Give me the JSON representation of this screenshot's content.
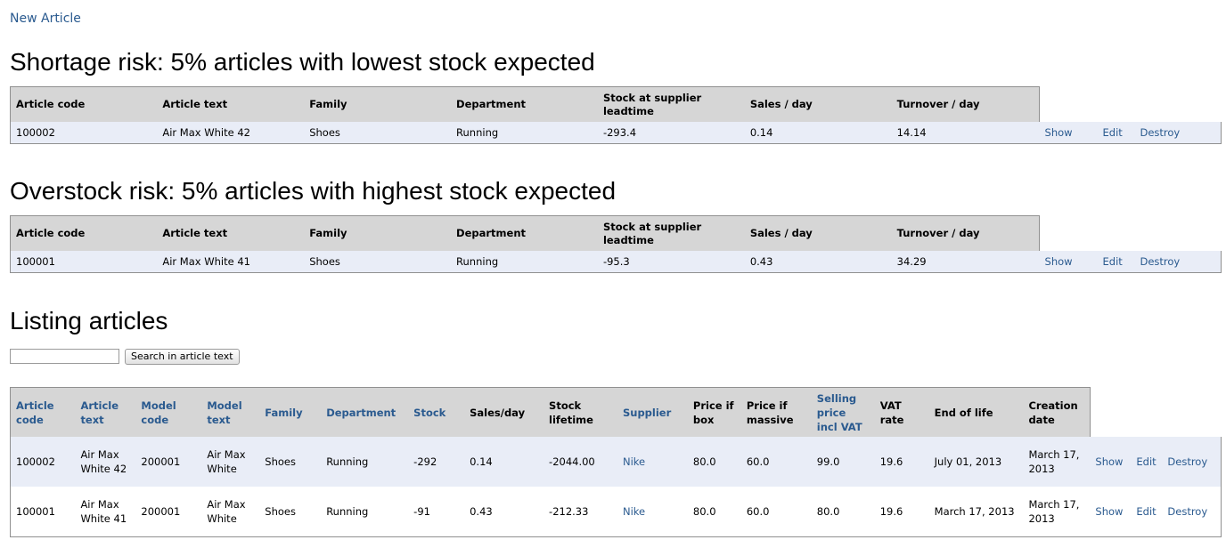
{
  "new_article_link": "New Article",
  "shortage": {
    "title": "Shortage risk: 5% articles with lowest stock expected",
    "headers": [
      "Article code",
      "Article text",
      "Family",
      "Department",
      "Stock at supplier leadtime",
      "Sales / day",
      "Turnover / day"
    ],
    "rows": [
      {
        "cells": [
          "100002",
          "Air Max White 42",
          "Shoes",
          "Running",
          "-293.4",
          "0.14",
          "14.14"
        ],
        "show": "Show",
        "edit": "Edit",
        "destroy": "Destroy"
      }
    ]
  },
  "overstock": {
    "title": "Overstock risk: 5% articles with highest stock expected",
    "headers": [
      "Article code",
      "Article text",
      "Family",
      "Department",
      "Stock at supplier leadtime",
      "Sales / day",
      "Turnover / day"
    ],
    "rows": [
      {
        "cells": [
          "100001",
          "Air Max White 41",
          "Shoes",
          "Running",
          "-95.3",
          "0.43",
          "34.29"
        ],
        "show": "Show",
        "edit": "Edit",
        "destroy": "Destroy"
      }
    ]
  },
  "listing": {
    "title": "Listing articles",
    "search_placeholder": "",
    "search_button": "Search in article text",
    "headers": [
      {
        "label": "Article code",
        "sortable": true
      },
      {
        "label": "Article text",
        "sortable": true
      },
      {
        "label": "Model code",
        "sortable": true
      },
      {
        "label": "Model text",
        "sortable": true
      },
      {
        "label": "Family",
        "sortable": true
      },
      {
        "label": "Department",
        "sortable": true
      },
      {
        "label": "Stock",
        "sortable": true
      },
      {
        "label": "Sales/day",
        "sortable": false
      },
      {
        "label": "Stock lifetime",
        "sortable": false
      },
      {
        "label": "Supplier",
        "sortable": true
      },
      {
        "label": "Price if box",
        "sortable": false
      },
      {
        "label": "Price if massive",
        "sortable": false
      },
      {
        "label": "Selling price incl VAT",
        "sortable": true
      },
      {
        "label": "VAT rate",
        "sortable": false
      },
      {
        "label": "End of life",
        "sortable": false
      },
      {
        "label": "Creation date",
        "sortable": false
      }
    ],
    "rows": [
      {
        "cells": [
          "100002",
          "Air Max White 42",
          "200001",
          "Air Max White",
          "Shoes",
          "Running",
          "-292",
          "0.14",
          "-2044.00",
          "Nike",
          "80.0",
          "60.0",
          "99.0",
          "19.6",
          "July 01, 2013",
          "March 17, 2013"
        ],
        "show": "Show",
        "edit": "Edit",
        "destroy": "Destroy"
      },
      {
        "cells": [
          "100001",
          "Air Max White 41",
          "200001",
          "Air Max White",
          "Shoes",
          "Running",
          "-91",
          "0.43",
          "-212.33",
          "Nike",
          "80.0",
          "60.0",
          "80.0",
          "19.6",
          "March 17, 2013",
          "March 17, 2013"
        ],
        "show": "Show",
        "edit": "Edit",
        "destroy": "Destroy"
      }
    ]
  }
}
